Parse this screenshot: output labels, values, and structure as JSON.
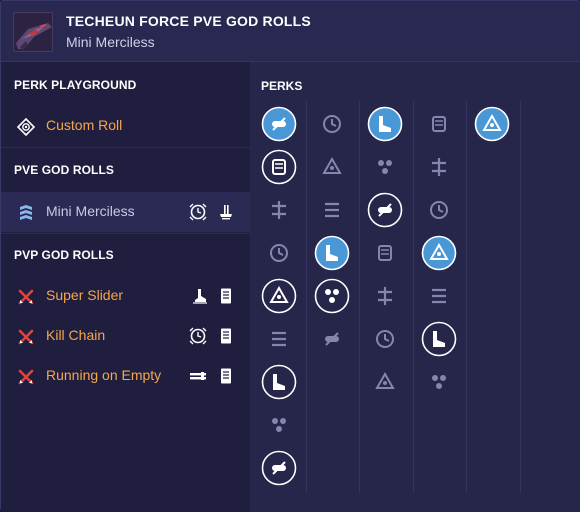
{
  "header": {
    "title": "TECHEUN FORCE PVE GOD ROLLS",
    "subtitle": "Mini Merciless",
    "thumbnail_icon": "weapon-thumbnail"
  },
  "sidebar": {
    "sections": [
      {
        "title": "PERK PLAYGROUND",
        "items": [
          {
            "label": "Custom Roll",
            "icon": "custom-roll-icon",
            "color": "#f7a64a",
            "perks": []
          }
        ]
      },
      {
        "title": "PVE GOD ROLLS",
        "items": [
          {
            "label": "Mini Merciless",
            "icon": "pve-chevron-icon",
            "color": "#c9c9e3",
            "active": true,
            "perks": [
              "clock-perk-icon",
              "stand-perk-icon"
            ]
          }
        ]
      },
      {
        "title": "PVP GOD ROLLS",
        "items": [
          {
            "label": "Super Slider",
            "icon": "pvp-crossed-icon",
            "color": "#f7a64a",
            "perks": [
              "boot-perk-icon",
              "mag-perk-icon"
            ]
          },
          {
            "label": "Kill Chain",
            "icon": "pvp-crossed-icon",
            "color": "#f7a64a",
            "perks": [
              "clock-perk-icon",
              "mag-perk-icon"
            ]
          },
          {
            "label": "Running on Empty",
            "icon": "pvp-crossed-icon",
            "color": "#f7a64a",
            "perks": [
              "barrel-perk-icon",
              "mag-perk-icon"
            ]
          }
        ]
      }
    ]
  },
  "perks": {
    "title": "PERKS",
    "accent": "#4a97d6",
    "columns": [
      [
        {
          "icon": "barrel-wrench-icon",
          "state": "selected"
        },
        {
          "icon": "fluted-barrel-icon",
          "state": "outlined"
        },
        {
          "icon": "smallbore-icon",
          "state": "dim"
        },
        {
          "icon": "chambered-compensator-icon",
          "state": "dim"
        },
        {
          "icon": "arrowhead-brake-icon",
          "state": "outlined"
        },
        {
          "icon": "corkscrew-rifling-icon",
          "state": "dim"
        },
        {
          "icon": "hammer-forged-icon",
          "state": "outlined"
        },
        {
          "icon": "full-bore-icon",
          "state": "dim"
        },
        {
          "icon": "extended-barrel-icon",
          "state": "outlined"
        }
      ],
      [
        {
          "icon": "tactical-mag-icon",
          "state": "dim"
        },
        {
          "icon": "appended-mag-icon",
          "state": "dim"
        },
        {
          "icon": "flared-magwell-icon",
          "state": "dim"
        },
        {
          "icon": "accurized-rounds-icon",
          "state": "selected"
        },
        {
          "icon": "ricochet-rounds-icon",
          "state": "outlined"
        },
        {
          "icon": "steady-rounds-icon",
          "state": "dim"
        }
      ],
      [
        {
          "icon": "tower-perk-icon",
          "state": "selected"
        },
        {
          "icon": "dragonfly-icon",
          "state": "dim"
        },
        {
          "icon": "spring-loaded-mag-icon",
          "state": "outlined"
        },
        {
          "icon": "battery-perk-icon",
          "state": "dim"
        },
        {
          "icon": "skull-perk-icon",
          "state": "dim"
        },
        {
          "icon": "swirl-perk-icon",
          "state": "dim"
        },
        {
          "icon": "crosshair-perk-icon",
          "state": "dim"
        }
      ],
      [
        {
          "icon": "slide-boot-icon",
          "state": "dim"
        },
        {
          "icon": "cluster-perk-icon",
          "state": "dim"
        },
        {
          "icon": "triad-perk-icon",
          "state": "dim"
        },
        {
          "icon": "timer-perk-icon",
          "state": "selected"
        },
        {
          "icon": "lightning-perk-icon",
          "state": "dim"
        },
        {
          "icon": "up-arrow-perk-icon",
          "state": "outlined"
        },
        {
          "icon": "dual-barrel-perk-icon",
          "state": "dim"
        }
      ],
      [
        {
          "icon": "masterwork-icon",
          "state": "selected"
        }
      ]
    ]
  }
}
